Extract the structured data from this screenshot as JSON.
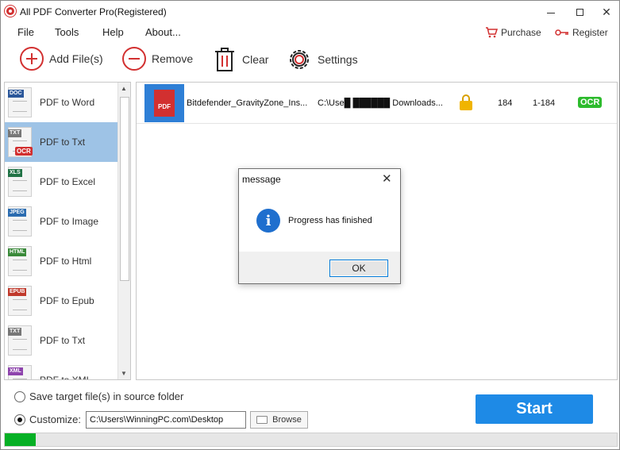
{
  "window": {
    "title": "All PDF Converter Pro(Registered)",
    "controls": {
      "minimize": "—",
      "close": "✕"
    }
  },
  "menu": {
    "items": [
      "File",
      "Tools",
      "Help",
      "About..."
    ],
    "purchase": "Purchase",
    "register": "Register"
  },
  "toolbar": {
    "add_files": "Add File(s)",
    "remove": "Remove",
    "clear": "Clear",
    "settings": "Settings"
  },
  "converters": [
    {
      "label": "PDF to Word",
      "tag": "DOC",
      "tag_color": "#2b579a",
      "selected": false,
      "ocr": false
    },
    {
      "label": "PDF to Txt",
      "tag": "TXT",
      "tag_color": "#777777",
      "selected": true,
      "ocr": true
    },
    {
      "label": "PDF to Excel",
      "tag": "XLS",
      "tag_color": "#217346",
      "selected": false,
      "ocr": false
    },
    {
      "label": "PDF to Image",
      "tag": "JPEG",
      "tag_color": "#2b6cb0",
      "selected": false,
      "ocr": false
    },
    {
      "label": "PDF to Html",
      "tag": "HTML",
      "tag_color": "#3a8a3a",
      "selected": false,
      "ocr": false
    },
    {
      "label": "PDF to Epub",
      "tag": "EPUB",
      "tag_color": "#c0392b",
      "selected": false,
      "ocr": false
    },
    {
      "label": "PDF to Txt",
      "tag": "TXT",
      "tag_color": "#777777",
      "selected": false,
      "ocr": false
    },
    {
      "label": "PDF to XML",
      "tag": "XML",
      "tag_color": "#8e44ad",
      "selected": false,
      "ocr": false
    }
  ],
  "ocr_label": "OCR",
  "files": [
    {
      "thumb_label": "PDF",
      "name": "Bitdefender_GravityZone_Ins...",
      "path": "C:\\Use█ ██████ Downloads...",
      "pages": "184",
      "range": "1-184",
      "ocr": "OCR"
    }
  ],
  "dialog": {
    "title": "message",
    "close": "✕",
    "icon": "i",
    "message": "Progress has finished",
    "ok": "OK"
  },
  "output": {
    "source_folder_label": "Save target file(s) in source folder",
    "customize_label": "Customize:",
    "path": "C:\\Users\\WinningPC.com\\Desktop",
    "browse": "Browse"
  },
  "start": "Start",
  "progress": {
    "fraction": 0.05,
    "color": "#06b025"
  },
  "colors": {
    "accent": "#1e8ae6",
    "brand_red": "#d23030",
    "selection": "#9ec3e6"
  }
}
